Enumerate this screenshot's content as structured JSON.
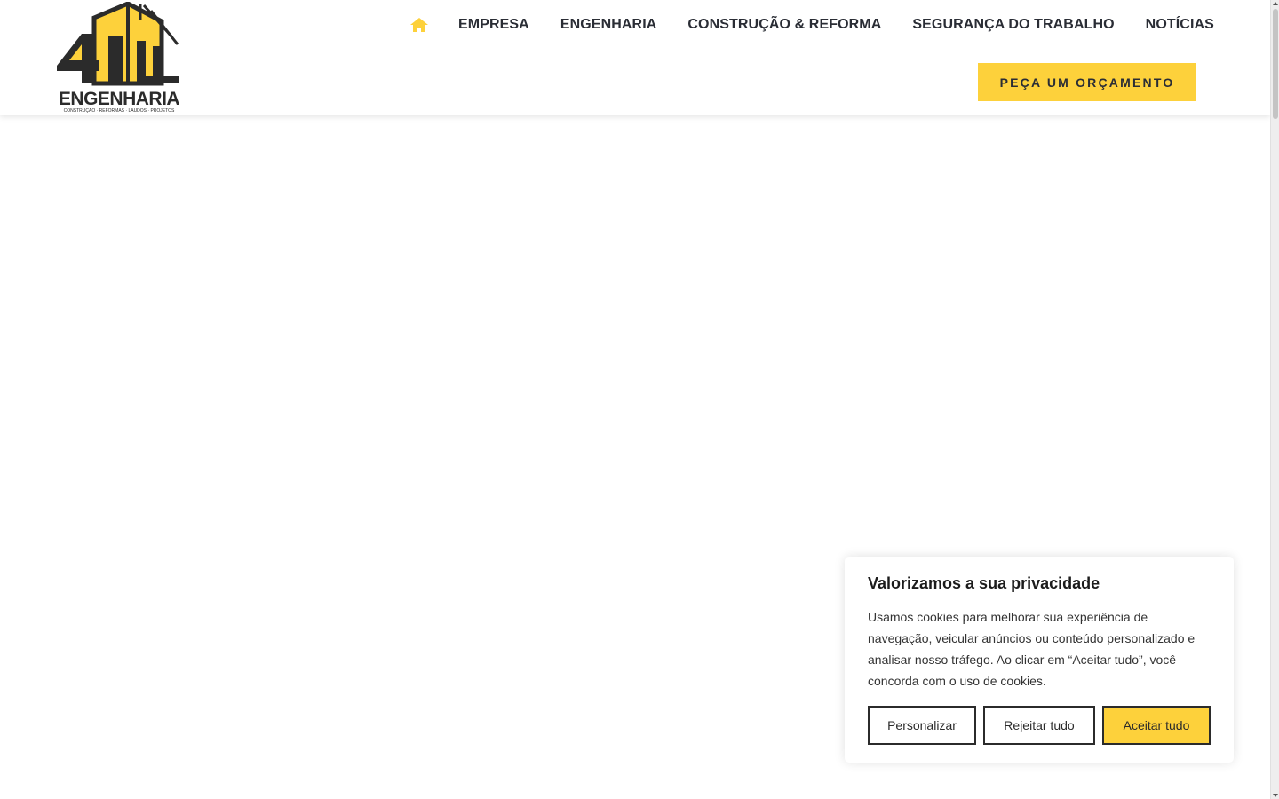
{
  "header": {
    "logo": {
      "text": "ENGENHARIA",
      "tagline": "CONSTRUÇÃO · REFORMAS · LAUDOS · PROJETOS",
      "mark": "4ALL"
    },
    "nav": {
      "home_icon": "home-icon",
      "items": [
        "EMPRESA",
        "ENGENHARIA",
        "CONSTRUÇÃO & REFORMA",
        "SEGURANÇA DO TRABALHO",
        "NOTÍCIAS"
      ]
    },
    "quote_button": "PEÇA UM ORÇAMENTO"
  },
  "cookie_banner": {
    "title": "Valorizamos a sua privacidade",
    "text": "Usamos cookies para melhorar sua experiência de navegação, veicular anúncios ou conteúdo personalizado e analisar nosso tráfego. Ao clicar em “Aceitar tudo”, você concorda com o uso de cookies.",
    "buttons": {
      "customize": "Personalizar",
      "reject": "Rejeitar tudo",
      "accept": "Aceitar tudo"
    }
  },
  "colors": {
    "accent": "#fdd13b",
    "text_dark": "#2a2d35",
    "background": "#ffffff"
  }
}
